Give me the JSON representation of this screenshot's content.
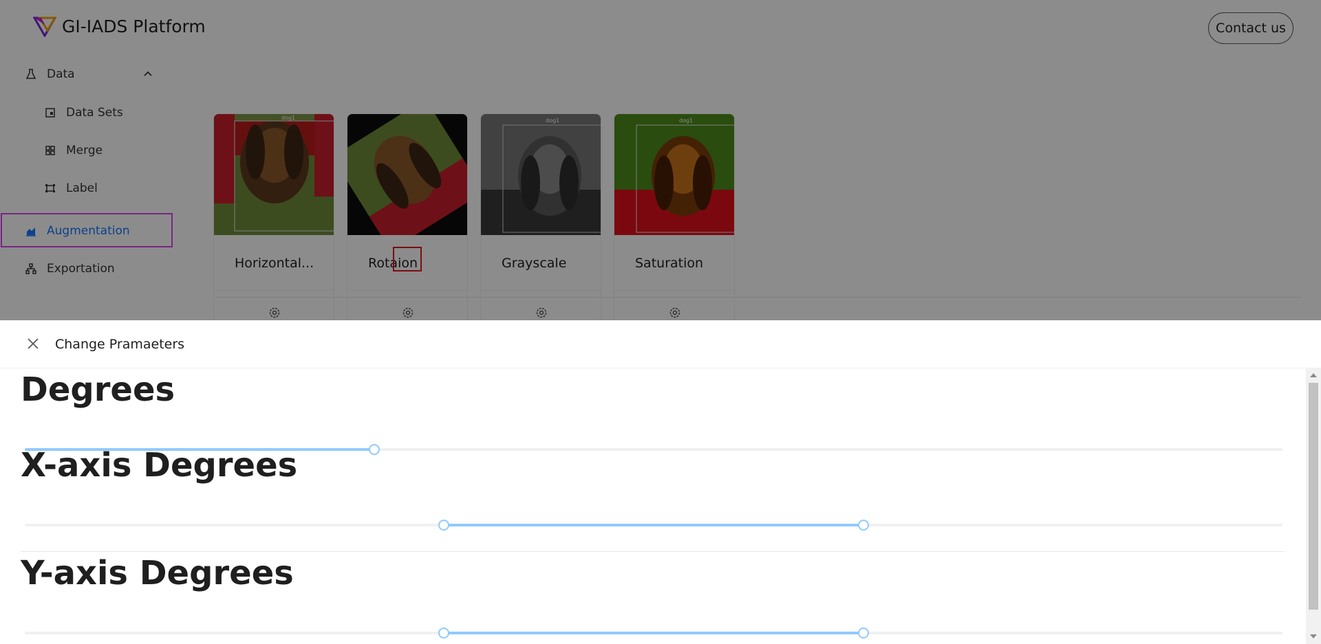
{
  "header": {
    "brand": "GI-IADS Platform",
    "contact_label": "Contact us",
    "logo_icon": "triangle-logo-icon"
  },
  "sidebar": {
    "items": [
      {
        "label": "Data",
        "icon": "flask-icon",
        "expanded": true
      },
      {
        "label": "Data Sets",
        "icon": "dataset-icon"
      },
      {
        "label": "Merge",
        "icon": "merge-icon"
      },
      {
        "label": "Label",
        "icon": "label-icon"
      },
      {
        "label": "Augmentation",
        "icon": "area-chart-icon",
        "active": true
      },
      {
        "label": "Exportation",
        "icon": "cluster-icon"
      }
    ]
  },
  "cards": [
    {
      "title": "Horizontal...",
      "image_label": "dog1",
      "action_icon": "setting-icon"
    },
    {
      "title": "Rotaion",
      "image_label": "",
      "action_icon": "setting-icon"
    },
    {
      "title": "Grayscale",
      "image_label": "dog1",
      "action_icon": "setting-icon"
    },
    {
      "title": "Saturation",
      "image_label": "dog1",
      "action_icon": "setting-icon"
    }
  ],
  "drawer": {
    "title": "Change Pramaeters",
    "close_icon": "close-icon",
    "sections": [
      {
        "title": "Degrees",
        "type": "single",
        "value": 0.278
      },
      {
        "title": "X-axis Degrees",
        "type": "range",
        "range": [
          0.333,
          0.667
        ]
      },
      {
        "title": "Y-axis Degrees",
        "type": "range",
        "range": [
          0.333,
          0.667
        ]
      }
    ]
  },
  "colors": {
    "accent": "#1677ff",
    "slider_track": "#91caff",
    "highlight_outline": "#d946ef",
    "gear_highlight": "#e0191f"
  }
}
